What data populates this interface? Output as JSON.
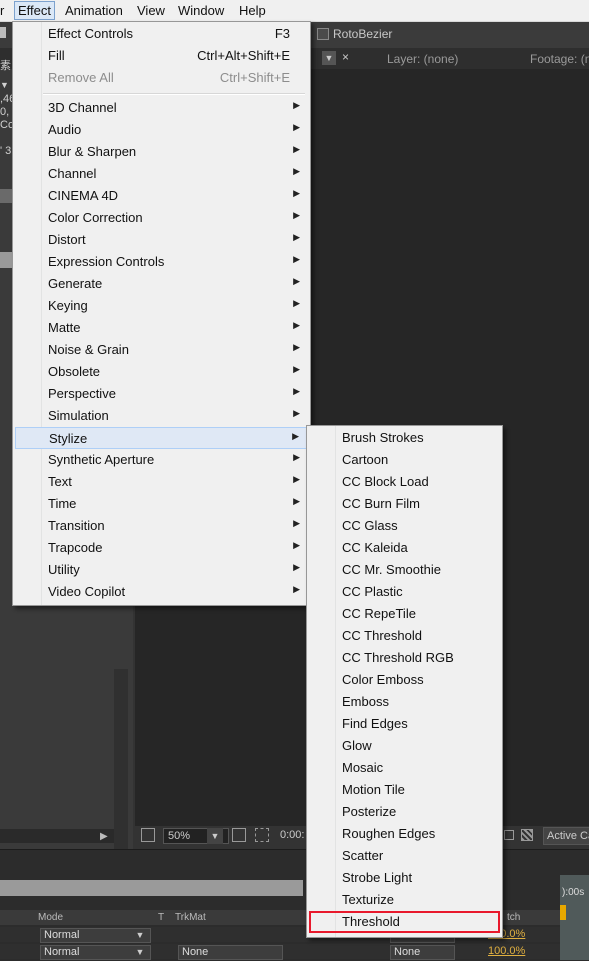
{
  "menubar": {
    "items": [
      {
        "label": "r"
      },
      {
        "label": "Effect"
      },
      {
        "label": "Animation"
      },
      {
        "label": "View"
      },
      {
        "label": "Window"
      },
      {
        "label": "Help"
      }
    ]
  },
  "toolbar": {
    "rotobezier_label": "RotoBezier"
  },
  "panel_header": {
    "layer_tab": "Layer: (none)",
    "footage_tab": "Footage: (n",
    "close": "×"
  },
  "left_panel": {
    "frag1": "素",
    "frag2": "▼",
    "frag3": ",46",
    "frag4": "0, 2",
    "frag5": "Col",
    "frag6": "' 3"
  },
  "viewer_footer": {
    "zoom": "50%",
    "timecode": "0:00:",
    "camera": "Active Ca"
  },
  "timeline": {
    "col_mode": "Mode",
    "col_t": "T",
    "col_trkmat": "TrkMat",
    "col_stretch": "tch",
    "ruler": "):00s",
    "rows": [
      {
        "mode": "Normal",
        "trkmat": "",
        "parent": "None",
        "stretch": "100.0%"
      },
      {
        "mode": "Normal",
        "trkmat": "None",
        "parent": "None",
        "stretch": "100.0%"
      }
    ]
  },
  "effect_menu": {
    "top_items": [
      {
        "label": "Effect Controls",
        "shortcut": "F3"
      },
      {
        "label": "Fill",
        "shortcut": "Ctrl+Alt+Shift+E"
      },
      {
        "label": "Remove All",
        "shortcut": "Ctrl+Shift+E"
      }
    ],
    "categories": [
      "3D Channel",
      "Audio",
      "Blur & Sharpen",
      "Channel",
      "CINEMA 4D",
      "Color Correction",
      "Distort",
      "Expression Controls",
      "Generate",
      "Keying",
      "Matte",
      "Noise & Grain",
      "Obsolete",
      "Perspective",
      "Simulation",
      "Stylize",
      "Synthetic Aperture",
      "Text",
      "Time",
      "Transition",
      "Trapcode",
      "Utility",
      "Video Copilot"
    ],
    "highlighted": "Stylize"
  },
  "stylize_menu": {
    "items": [
      "Brush Strokes",
      "Cartoon",
      "CC Block Load",
      "CC Burn Film",
      "CC Glass",
      "CC Kaleida",
      "CC Mr. Smoothie",
      "CC Plastic",
      "CC RepeTile",
      "CC Threshold",
      "CC Threshold RGB",
      "Color Emboss",
      "Emboss",
      "Find Edges",
      "Glow",
      "Mosaic",
      "Motion Tile",
      "Posterize",
      "Roughen Edges",
      "Scatter",
      "Strobe Light",
      "Texturize",
      "Threshold"
    ],
    "marked": "Threshold"
  },
  "colors": {
    "highlight_border": "#aecff7",
    "highlight_fill": "#dfe8f5",
    "marker_red": "#e8192c",
    "timeline_value": "#e0b040"
  }
}
